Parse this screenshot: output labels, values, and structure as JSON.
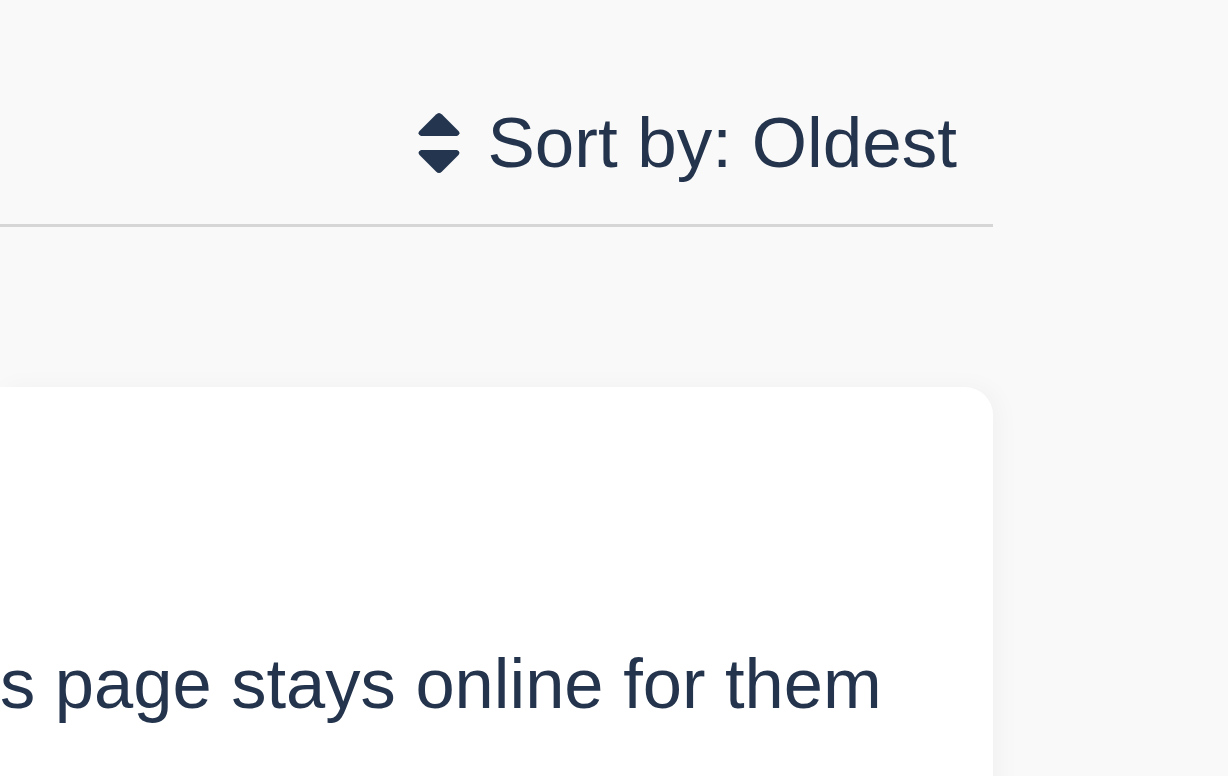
{
  "sort": {
    "label": "Sort by: Oldest"
  },
  "card": {
    "text": "s page stays online for them"
  }
}
